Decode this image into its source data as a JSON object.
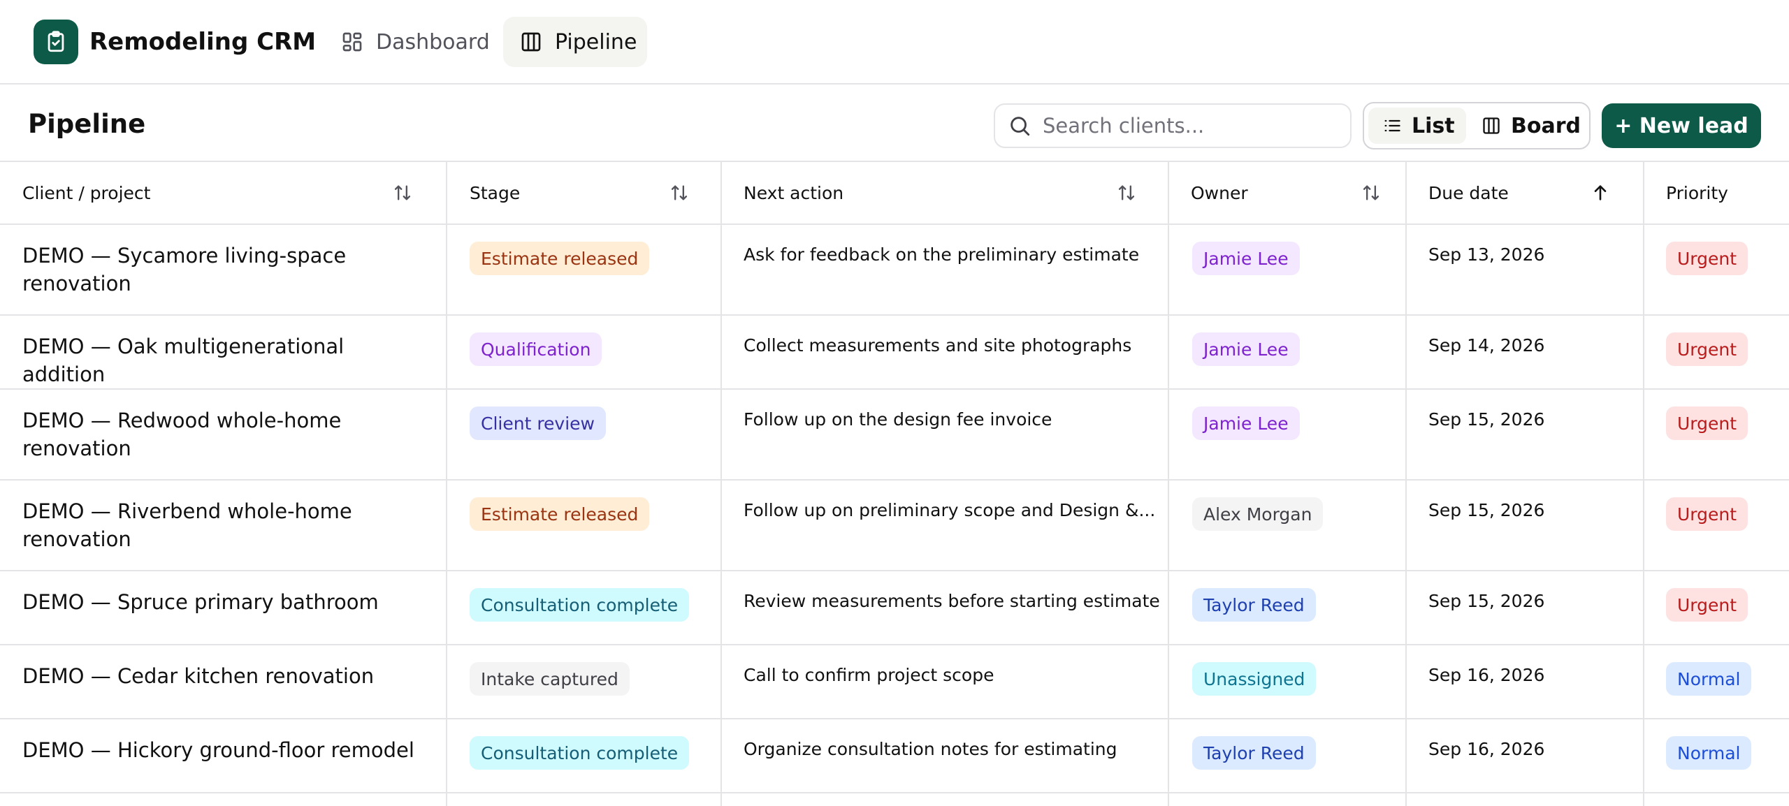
{
  "app": {
    "name": "Remodeling CRM",
    "nav": [
      {
        "label": "Dashboard",
        "icon": "dashboard-grid-icon",
        "active": false
      },
      {
        "label": "Pipeline",
        "icon": "columns-icon",
        "active": true
      }
    ]
  },
  "toolbar": {
    "title": "Pipeline",
    "search_placeholder": "Search clients...",
    "view_list_label": "List",
    "view_board_label": "Board",
    "active_view": "List",
    "new_lead_label": "+ New lead"
  },
  "colors": {
    "brand": "#0c5a47",
    "estimate_released_bg": "#ffedd5",
    "estimate_released_fg": "#9a3412",
    "qualification_bg": "#f3e8ff",
    "qualification_fg": "#7e22ce",
    "client_review_bg": "#e0e7ff",
    "client_review_fg": "#3730a3",
    "consultation_complete_bg": "#cffafe",
    "consultation_complete_fg": "#155e75",
    "intake_captured_bg": "#f4f4f5",
    "intake_captured_fg": "#3f3f46",
    "urgent_bg": "#fee2e2",
    "urgent_fg": "#b91c1c",
    "normal_bg": "#dbeafe",
    "normal_fg": "#1d4ed8"
  },
  "table": {
    "columns": [
      {
        "label": "Client / project",
        "sort": "none"
      },
      {
        "label": "Stage",
        "sort": "none"
      },
      {
        "label": "Next action",
        "sort": "none"
      },
      {
        "label": "Owner",
        "sort": "none"
      },
      {
        "label": "Due date",
        "sort": "ascending"
      },
      {
        "label": "Priority",
        "sort": "none"
      }
    ],
    "rows": [
      {
        "client": "DEMO — Sycamore living-space renovation",
        "stage": "Estimate released",
        "next_action": "Ask for feedback on the preliminary estimate",
        "owner": "Jamie Lee",
        "due": "Sep 13, 2026",
        "priority": "Urgent"
      },
      {
        "client": "DEMO — Oak multigenerational addition",
        "stage": "Qualification",
        "next_action": "Collect measurements and site photographs",
        "owner": "Jamie Lee",
        "due": "Sep 14, 2026",
        "priority": "Urgent"
      },
      {
        "client": "DEMO — Redwood whole-home renovation",
        "stage": "Client review",
        "next_action": "Follow up on the design fee invoice",
        "owner": "Jamie Lee",
        "due": "Sep 15, 2026",
        "priority": "Urgent"
      },
      {
        "client": "DEMO — Riverbend whole-home renovation",
        "stage": "Estimate released",
        "next_action": "Follow up on preliminary scope and Design &...",
        "owner": "Alex Morgan",
        "due": "Sep 15, 2026",
        "priority": "Urgent"
      },
      {
        "client": "DEMO — Spruce primary bathroom",
        "stage": "Consultation complete",
        "next_action": "Review measurements before starting estimate",
        "owner": "Taylor Reed",
        "due": "Sep 15, 2026",
        "priority": "Urgent"
      },
      {
        "client": "DEMO — Cedar kitchen renovation",
        "stage": "Intake captured",
        "next_action": "Call to confirm project scope",
        "owner": "Unassigned",
        "due": "Sep 16, 2026",
        "priority": "Normal"
      },
      {
        "client": "DEMO — Hickory ground-floor remodel",
        "stage": "Consultation complete",
        "next_action": "Organize consultation notes for estimating",
        "owner": "Taylor Reed",
        "due": "Sep 16, 2026",
        "priority": "Normal"
      }
    ]
  }
}
